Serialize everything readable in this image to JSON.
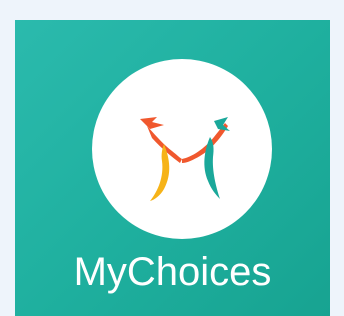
{
  "app": {
    "name": "MyChoices",
    "logo_icon": "mychoices-logo-icon"
  },
  "colors": {
    "tile_background": "#1fb09f",
    "logo_circle": "#ffffff",
    "logo_orange": "#f0582e",
    "logo_yellow": "#f6b318",
    "logo_teal": "#1aa89a",
    "label": "#ffffff"
  }
}
